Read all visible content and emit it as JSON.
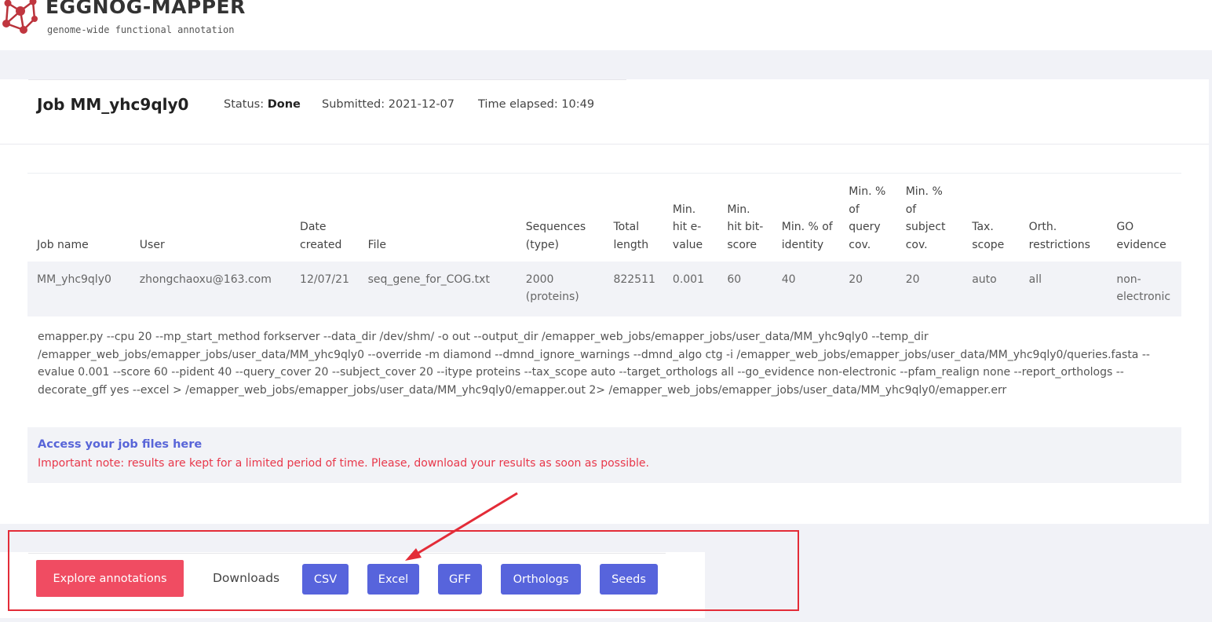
{
  "header": {
    "app_name": "EGGNOG-MAPPER",
    "tagline": "genome-wide functional annotation"
  },
  "job": {
    "title": "Job MM_yhc9qly0",
    "status_label": "Status:",
    "status_value": "Done",
    "submitted": "Submitted: 2021-12-07",
    "elapsed": "Time elapsed: 10:49"
  },
  "table": {
    "headers": [
      "Job name",
      "User",
      "Date created",
      "File",
      "Sequences (type)",
      "Total length",
      "Min. hit e-value",
      "Min. hit bit-score",
      "Min. % of identity",
      "Min. % of query cov.",
      "Min. % of subject cov.",
      "Tax. scope",
      "Orth. restrictions",
      "GO evidence"
    ],
    "row": [
      "MM_yhc9qly0",
      "zhongchaoxu@163.com",
      "12/07/21",
      "seq_gene_for_COG.txt",
      "2000 (proteins)",
      "822511",
      "0.001",
      "60",
      "40",
      "20",
      "20",
      "auto",
      "all",
      "non-electronic"
    ]
  },
  "command": "emapper.py --cpu 20 --mp_start_method forkserver --data_dir /dev/shm/ -o out --output_dir /emapper_web_jobs/emapper_jobs/user_data/MM_yhc9qly0 --temp_dir /emapper_web_jobs/emapper_jobs/user_data/MM_yhc9qly0 --override -m diamond --dmnd_ignore_warnings --dmnd_algo ctg -i /emapper_web_jobs/emapper_jobs/user_data/MM_yhc9qly0/queries.fasta --evalue 0.001 --score 60 --pident 40 --query_cover 20 --subject_cover 20 --itype proteins --tax_scope auto --target_orthologs all --go_evidence non-electronic --pfam_realign none --report_orthologs --decorate_gff yes --excel > /emapper_web_jobs/emapper_jobs/user_data/MM_yhc9qly0/emapper.out 2> /emapper_web_jobs/emapper_jobs/user_data/MM_yhc9qly0/emapper.err",
  "access": {
    "link": "Access your job files here",
    "note": "Important note: results are kept for a limited period of time. Please, download your results as soon as possible."
  },
  "actions": {
    "explore": "Explore annotations",
    "downloads_label": "Downloads",
    "csv": "CSV",
    "excel": "Excel",
    "gff": "GFF",
    "orthologs": "Orthologs",
    "seeds": "Seeds"
  },
  "colors": {
    "primary_button": "#5764dc",
    "explore_button": "#f04c62",
    "warning_text": "#e8374a",
    "annotation_red": "#e32c38"
  }
}
